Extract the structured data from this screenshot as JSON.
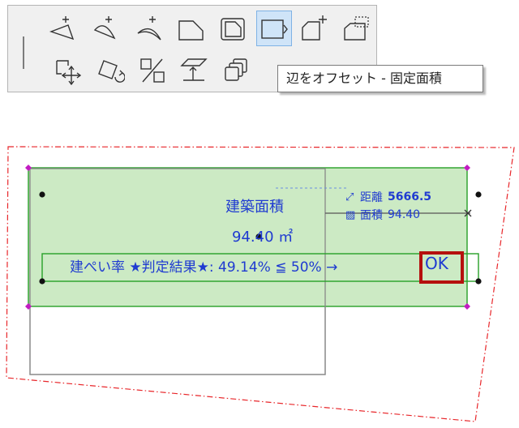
{
  "toolbar": {
    "active_tool": "offset-edge-fixed-area",
    "tooltip": "辺をオフセット - 固定面積"
  },
  "drawing": {
    "zone_name": "建築面積",
    "zone_area": "94.40 ㎡",
    "coverage_text": "建ぺい率 ★判定結果★: 49.14%  ≦  50% →",
    "ok_text": "OK",
    "distance_label": "距離",
    "distance_value": "5666.5",
    "area_label": "面積",
    "area_value": "94.40"
  },
  "colors": {
    "zone_fill": "#c6e8be",
    "zone_border": "#27a027",
    "text_blue": "#1f3bd1",
    "ok_frame": "#b5100e",
    "site_line": "#e8262a",
    "vertex_magenta": "#c21bc2"
  }
}
